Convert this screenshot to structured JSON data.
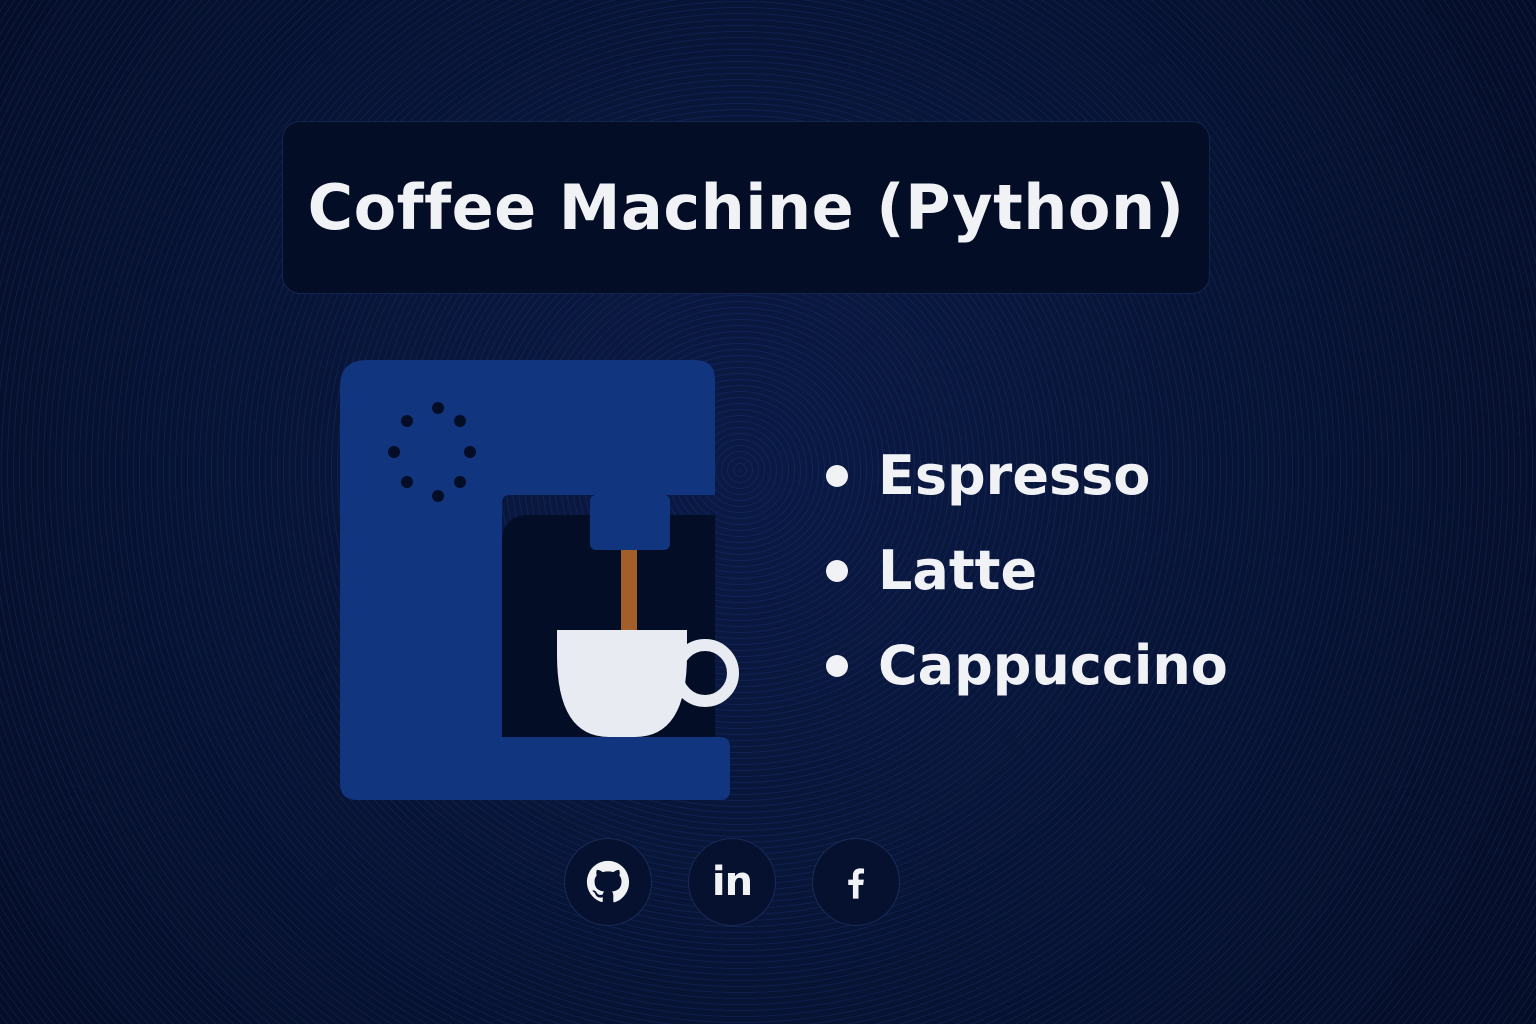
{
  "title": "Coffee Machine (Python)",
  "menu": {
    "items": [
      {
        "label": "Espresso"
      },
      {
        "label": "Latte"
      },
      {
        "label": "Cappuccino"
      }
    ]
  },
  "social": {
    "links": [
      {
        "icon": "github-icon"
      },
      {
        "icon": "linkedin-icon",
        "glyph": "in"
      },
      {
        "icon": "facebook-icon"
      }
    ]
  },
  "colors": {
    "background": "#071230",
    "card": "#040d26",
    "machine": "#12357f",
    "machine_dark": "#040d26",
    "coffee_stream": "#a35f2a",
    "cup": "#e8ecf2",
    "text": "#f0f2f6"
  }
}
